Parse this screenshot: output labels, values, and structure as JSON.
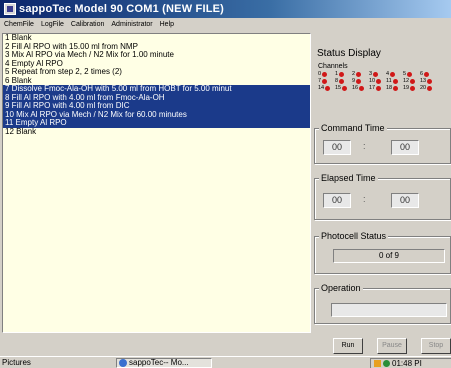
{
  "window": {
    "title": "sappoTec   Model 90   COM1 (NEW FILE)"
  },
  "menu": [
    "ChemFile",
    "LogFile",
    "Calibration",
    "Administrator",
    "Help"
  ],
  "steps": [
    {
      "text": "1  Blank",
      "selected": false
    },
    {
      "text": "2  Fill Al RPO with 15.00 ml  from NMP",
      "selected": false
    },
    {
      "text": "3  Mix Al RPO via Mech / N2 Mix for 1.00 minute",
      "selected": false
    },
    {
      "text": "4  Empty Al RPO",
      "selected": false
    },
    {
      "text": "5  Repeat from step 2, 2 times  (2)",
      "selected": false
    },
    {
      "text": "6  Blank",
      "selected": false
    },
    {
      "text": "7  Dissolve Fmoc-Ala-OH with 5.00 ml  from HOBT for 5.00 minut",
      "selected": true
    },
    {
      "text": "8  Fill Al RPO with 4.00 ml  from Fmoc-Ala-OH",
      "selected": true
    },
    {
      "text": "9  Fill Al RPO with 4.00 ml  from DIC",
      "selected": true
    },
    {
      "text": "10  Mix Al RPO via Mech / N2 Mix for 60.00 minutes",
      "selected": true
    },
    {
      "text": "11  Empty Al RPO",
      "selected": true
    },
    {
      "text": "12  Blank",
      "selected": false
    }
  ],
  "status": {
    "title": "Status Display",
    "channels_label": "Channels",
    "channels": [
      "0",
      "1",
      "2",
      "3",
      "4",
      "5",
      "6",
      "7",
      "8",
      "9",
      "10",
      "11",
      "12",
      "13",
      "14",
      "15",
      "16",
      "17",
      "18",
      "19",
      "20"
    ],
    "command_time": {
      "label": "Command Time",
      "hours": "00",
      "minutes": "00",
      "separator": ":"
    },
    "elapsed_time": {
      "label": "Elapsed Time",
      "hours": "00",
      "minutes": "00",
      "separator": ":"
    },
    "photocell": {
      "label": "Photocell Status",
      "value": "0 of 9"
    },
    "operation": {
      "label": "Operation",
      "value": ""
    }
  },
  "buttons": {
    "run": "Run",
    "pause": "Pause",
    "stop": "Stop"
  },
  "taskbar": {
    "pictures": "Pictures",
    "app_task": "sappoTec-- Mo...",
    "clock": "01:48 PI"
  },
  "colors": {
    "selection": "#1b3a8a",
    "list_bg": "#ffffe5",
    "led": "#d01818",
    "titlebar": "#0a246a"
  }
}
